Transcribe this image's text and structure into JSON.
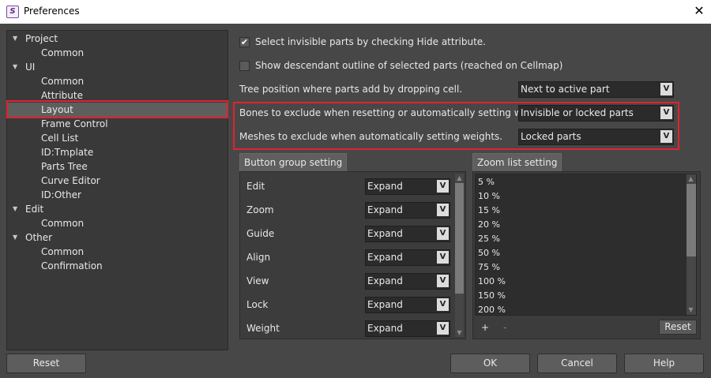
{
  "window": {
    "title": "Preferences",
    "close_glyph": "✕"
  },
  "tree": [
    {
      "label": "Project",
      "level": 0,
      "expanded": true
    },
    {
      "label": "Common",
      "level": 1
    },
    {
      "label": "UI",
      "level": 0,
      "expanded": true
    },
    {
      "label": "Common",
      "level": 1
    },
    {
      "label": "Attribute",
      "level": 1
    },
    {
      "label": "Layout",
      "level": 1,
      "selected": true
    },
    {
      "label": "Frame Control",
      "level": 1
    },
    {
      "label": "Cell List",
      "level": 1
    },
    {
      "label": "ID:Tmplate",
      "level": 1
    },
    {
      "label": "Parts Tree",
      "level": 1
    },
    {
      "label": "Curve Editor",
      "level": 1
    },
    {
      "label": "ID:Other",
      "level": 1
    },
    {
      "label": "Edit",
      "level": 0,
      "expanded": true
    },
    {
      "label": "Common",
      "level": 1
    },
    {
      "label": "Other",
      "level": 0,
      "expanded": true
    },
    {
      "label": "Common",
      "level": 1
    },
    {
      "label": "Confirmation",
      "level": 1
    }
  ],
  "settings": {
    "select_invisible": {
      "label": "Select invisible parts by checking Hide attribute.",
      "checked": true,
      "check_glyph": "✔"
    },
    "show_outline": {
      "label": "Show descendant outline of selected parts (reached on Cellmap)",
      "checked": false
    },
    "tree_position": {
      "label": "Tree position where parts add by dropping cell.",
      "value": "Next to active part"
    },
    "bones_exclude": {
      "label": "Bones to exclude when resetting or automatically setting weights.",
      "value": "Invisible or locked parts"
    },
    "meshes_exclude": {
      "label": "Meshes to exclude when automatically setting weights.",
      "value": "Locked parts"
    },
    "chevron_glyph": "V"
  },
  "button_group": {
    "title": "Button group setting",
    "rows": [
      {
        "label": "Edit",
        "value": "Expand"
      },
      {
        "label": "Zoom",
        "value": "Expand"
      },
      {
        "label": "Guide",
        "value": "Expand"
      },
      {
        "label": "Align",
        "value": "Expand"
      },
      {
        "label": "View",
        "value": "Expand"
      },
      {
        "label": "Lock",
        "value": "Expand"
      },
      {
        "label": "Weight",
        "value": "Expand"
      }
    ]
  },
  "zoom_list": {
    "title": "Zoom list setting",
    "items": [
      "5 %",
      "10 %",
      "15 %",
      "20 %",
      "25 %",
      "50 %",
      "75 %",
      "100 %",
      "150 %",
      "200 %"
    ],
    "add_label": "+",
    "remove_label": "-",
    "reset_label": "Reset"
  },
  "footer": {
    "reset_label": "Reset",
    "ok_label": "OK",
    "cancel_label": "Cancel",
    "help_label": "Help"
  },
  "colors": {
    "highlight": "#e3212f",
    "background": "#474747"
  }
}
